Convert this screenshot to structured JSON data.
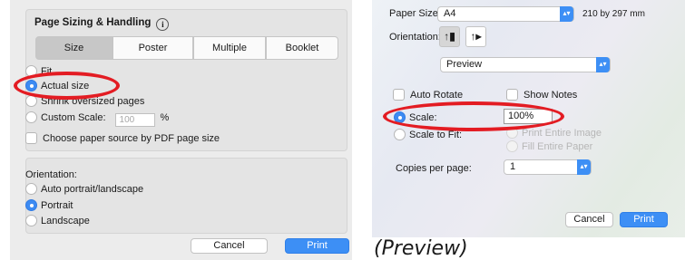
{
  "left_dialog": {
    "section_title": "Page Sizing & Handling",
    "info_icon": "info-icon",
    "tabs": [
      {
        "label": "Size",
        "selected": true
      },
      {
        "label": "Poster",
        "selected": false
      },
      {
        "label": "Multiple",
        "selected": false
      },
      {
        "label": "Booklet",
        "selected": false
      }
    ],
    "size_options": {
      "fit": "Fit",
      "actual_size": "Actual size",
      "shrink": "Shrink oversized pages",
      "custom_scale": "Custom Scale:",
      "custom_scale_value": "100",
      "percent": "%",
      "selected": "actual_size"
    },
    "paper_source_label": "Choose paper source by PDF page size",
    "orientation": {
      "label": "Orientation:",
      "options": [
        "Auto portrait/landscape",
        "Portrait",
        "Landscape"
      ],
      "selected": "Portrait"
    },
    "cancel_label": "Cancel",
    "print_label": "Print"
  },
  "right_dialog": {
    "paper_size_label": "Paper Size:",
    "paper_size_value": "A4",
    "paper_size_dims": "210 by 297 mm",
    "orientation_label": "Orientation:",
    "orientation_selected": "portrait",
    "app_menu_value": "Preview",
    "auto_rotate_label": "Auto Rotate",
    "show_notes_label": "Show Notes",
    "scale_label": "Scale:",
    "scale_value": "100%",
    "scale_to_fit_label": "Scale to Fit:",
    "print_entire_image_label": "Print Entire Image",
    "fill_entire_paper_label": "Fill Entire Paper",
    "copies_label": "Copies per page:",
    "copies_value": "1",
    "cancel_label": "Cancel",
    "print_label": "Print"
  },
  "caption": "(Preview)",
  "colors": {
    "accent_blue": "#3d8ff5",
    "annotation_red": "#e31c23"
  }
}
